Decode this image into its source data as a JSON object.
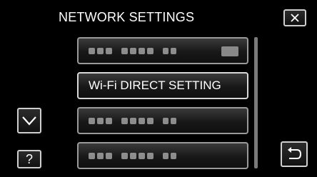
{
  "header": {
    "title": "NETWORK SETTINGS"
  },
  "buttons": {
    "close_icon": "close-icon",
    "down_icon": "chevron-down-icon",
    "help_label": "?",
    "back_icon": "return-arrow-icon"
  },
  "menu": {
    "items": [
      {
        "label": "",
        "obscured": true,
        "has_tag": true
      },
      {
        "label": "Wi-Fi DIRECT SETTING",
        "obscured": false,
        "selected": true
      },
      {
        "label": "",
        "obscured": true
      },
      {
        "label": "",
        "obscured": true
      }
    ]
  },
  "colors": {
    "background": "#000000",
    "text": "#ffffff",
    "border": "#cfcfcf"
  }
}
